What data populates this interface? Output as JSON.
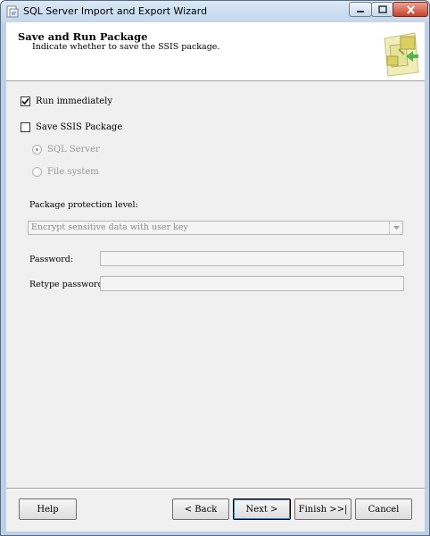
{
  "window": {
    "title": "SQL Server Import and Export Wizard"
  },
  "header": {
    "title": "Save and Run Package",
    "subtitle": "Indicate whether to save the SSIS package."
  },
  "options": {
    "run_immediately": {
      "label": "Run immediately",
      "checked": true
    },
    "save_package": {
      "label": "Save SSIS Package",
      "checked": false
    },
    "destination": {
      "sql_server": {
        "label": "SQL Server",
        "selected": true
      },
      "file_system": {
        "label": "File system",
        "selected": false
      }
    }
  },
  "protection": {
    "label": "Package protection level:",
    "selected": "Encrypt sensitive data with user key"
  },
  "password": {
    "label": "Password:",
    "value": ""
  },
  "retype_password": {
    "label": "Retype password:",
    "value": ""
  },
  "buttons": {
    "help": "Help",
    "back": "< Back",
    "next": "Next >",
    "finish": "Finish >>|",
    "cancel": "Cancel"
  },
  "colors": {
    "window_frame": "#bcd1e8",
    "client_bg": "#f0f0f0",
    "disabled_text": "#9a9a9a"
  }
}
